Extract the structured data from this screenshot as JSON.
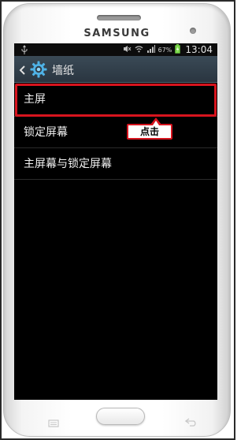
{
  "device": {
    "brand": "SAMSUNG"
  },
  "status_bar": {
    "battery_percent": "67%",
    "time": "13:04"
  },
  "action_bar": {
    "title": "墙纸"
  },
  "list": {
    "items": [
      {
        "label": "主屏",
        "highlighted": true
      },
      {
        "label": "锁定屏幕",
        "highlighted": false
      },
      {
        "label": "主屏幕与锁定屏幕",
        "highlighted": false
      }
    ]
  },
  "callout": {
    "text": "点击",
    "color": "#d7141e"
  },
  "icons": [
    "usb-icon",
    "signal-icon",
    "wifi-icon",
    "battery-icon",
    "back-arrow-icon",
    "gear-icon",
    "menu-key-icon",
    "back-key-icon"
  ]
}
